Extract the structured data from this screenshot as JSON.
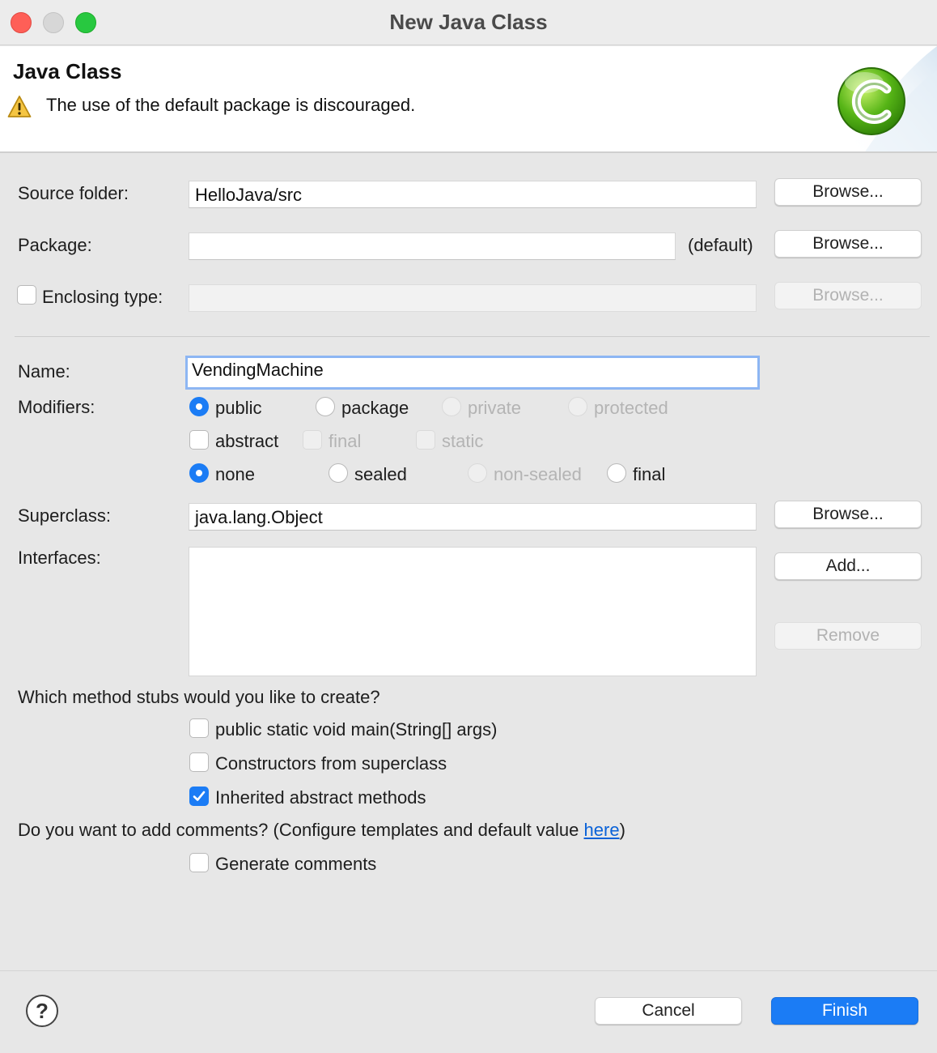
{
  "window": {
    "title": "New Java Class"
  },
  "banner": {
    "title": "Java Class",
    "warning_icon": "warning-triangle-icon",
    "message": "The use of the default package is discouraged.",
    "art_icon": "java-class-c-logo-icon"
  },
  "source_folder": {
    "label": "Source folder:",
    "value": "HelloJava/src",
    "browse_label": "Browse..."
  },
  "package": {
    "label": "Package:",
    "value": "",
    "suffix": "(default)",
    "browse_label": "Browse..."
  },
  "enclosing_type": {
    "label": "Enclosing type:",
    "checked": false,
    "value": "",
    "browse_label": "Browse..."
  },
  "name": {
    "label": "Name:",
    "value": "VendingMachine"
  },
  "modifiers": {
    "label": "Modifiers:",
    "access": [
      {
        "label": "public",
        "selected": true,
        "enabled": true
      },
      {
        "label": "package",
        "selected": false,
        "enabled": true
      },
      {
        "label": "private",
        "selected": false,
        "enabled": false
      },
      {
        "label": "protected",
        "selected": false,
        "enabled": false
      }
    ],
    "flags": [
      {
        "label": "abstract",
        "checked": false,
        "enabled": true
      },
      {
        "label": "final",
        "checked": false,
        "enabled": false
      },
      {
        "label": "static",
        "checked": false,
        "enabled": false
      }
    ],
    "sealing": [
      {
        "label": "none",
        "selected": true,
        "enabled": true
      },
      {
        "label": "sealed",
        "selected": false,
        "enabled": true
      },
      {
        "label": "non-sealed",
        "selected": false,
        "enabled": false
      },
      {
        "label": "final",
        "selected": false,
        "enabled": true
      }
    ]
  },
  "superclass": {
    "label": "Superclass:",
    "value": "java.lang.Object",
    "browse_label": "Browse..."
  },
  "interfaces": {
    "label": "Interfaces:",
    "items": [],
    "add_label": "Add...",
    "remove_label": "Remove"
  },
  "stubs": {
    "question": "Which method stubs would you like to create?",
    "options": [
      {
        "label": "public static void main(String[] args)",
        "checked": false
      },
      {
        "label": "Constructors from superclass",
        "checked": false
      },
      {
        "label": "Inherited abstract methods",
        "checked": true
      }
    ]
  },
  "comments": {
    "question_prefix": "Do you want to add comments? (Configure templates and default value ",
    "link_text": "here",
    "question_suffix": ")",
    "option": {
      "label": "Generate comments",
      "checked": false
    }
  },
  "footer": {
    "help_icon": "help-question-icon",
    "help_glyph": "?",
    "cancel_label": "Cancel",
    "finish_label": "Finish"
  },
  "colors": {
    "accent": "#1b7cf5",
    "link": "#0a62d8",
    "close": "#fe5f57",
    "maximize": "#28c840"
  }
}
